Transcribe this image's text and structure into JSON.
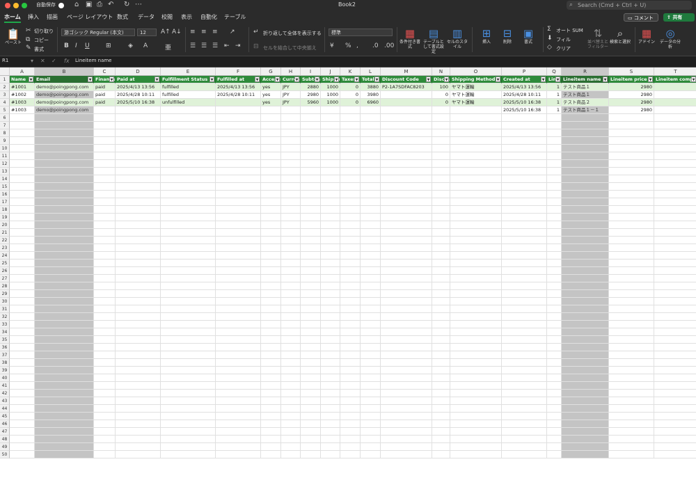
{
  "titlebar": {
    "autosave_label": "自動保存",
    "title": "Book2",
    "search_placeholder": "Search (Cmd + Ctrl + U)"
  },
  "menu": {
    "items": [
      "ホーム",
      "挿入",
      "描画",
      "ページ レイアウト",
      "数式",
      "データ",
      "校閲",
      "表示",
      "自動化",
      "テーブル"
    ],
    "comment_label": "コメント",
    "share_label": "共有"
  },
  "ribbon": {
    "paste": "ペースト",
    "cut": "切り取り",
    "copy": "コピー",
    "format": "書式",
    "font_name": "游ゴシック Regular (本文)",
    "font_size": "12",
    "wrap_text": "折り返して全体を表示する",
    "merge_center": "セルを結合して中央揃え",
    "number_format": "標準",
    "conditional_format": "条件付き書式",
    "format_as_table": "テーブルとして書式設定",
    "cell_styles": "セルのスタイル",
    "insert": "挿入",
    "delete": "削除",
    "format_cells": "書式",
    "autosum": "オート SUM",
    "fill": "フィル",
    "clear": "クリア",
    "sort_filter": "並べ替えとフィルター",
    "find_select": "検索と選択",
    "addins": "アドイン",
    "analyze_data": "データの分析"
  },
  "formula_bar": {
    "name_box": "R1",
    "content": "Lineitem name"
  },
  "grid": {
    "columns": [
      {
        "letter": "A",
        "header": "Name"
      },
      {
        "letter": "B",
        "header": "Email"
      },
      {
        "letter": "C",
        "header": "Financial Status"
      },
      {
        "letter": "D",
        "header": "Paid at"
      },
      {
        "letter": "E",
        "header": "Fulfillment Status"
      },
      {
        "letter": "F",
        "header": "Fulfilled at"
      },
      {
        "letter": "G",
        "header": "Accepts Marketing"
      },
      {
        "letter": "H",
        "header": "Currency"
      },
      {
        "letter": "I",
        "header": "Subtotal"
      },
      {
        "letter": "J",
        "header": "Shipping"
      },
      {
        "letter": "K",
        "header": "Taxes"
      },
      {
        "letter": "L",
        "header": "Total"
      },
      {
        "letter": "M",
        "header": "Discount Code"
      },
      {
        "letter": "N",
        "header": "Discount Amount"
      },
      {
        "letter": "O",
        "header": "Shipping Method"
      },
      {
        "letter": "P",
        "header": "Created at"
      },
      {
        "letter": "Q",
        "header": "Lineitem quantity"
      },
      {
        "letter": "R",
        "header": "Lineitem name"
      },
      {
        "letter": "S",
        "header": "Lineitem price"
      },
      {
        "letter": "T",
        "header": "Lineitem compare"
      }
    ],
    "rows": [
      [
        "#1001",
        "demo@poingpong.com",
        "paid",
        "2025/4/13 13:56",
        "fulfilled",
        "2025/4/13 13:56",
        "yes",
        "JPY",
        "2880",
        "1000",
        "0",
        "3880",
        "P2-1A7SDFAC8203",
        "100",
        "ヤマト運輸",
        "2025/4/13 13:56",
        "1",
        "テスト商品１",
        "2980",
        ""
      ],
      [
        "#1002",
        "demo@poingpong.com",
        "paid",
        "2025/4/28 10:11",
        "fulfilled",
        "2025/4/28 10:11",
        "yes",
        "JPY",
        "2980",
        "1000",
        "0",
        "3980",
        "",
        "0",
        "ヤマト運輸",
        "2025/4/28 10:11",
        "1",
        "テスト商品１",
        "2980",
        ""
      ],
      [
        "#1003",
        "demo@poingpong.com",
        "paid",
        "2025/5/10 16:38",
        "unfulfilled",
        "",
        "yes",
        "JPY",
        "5960",
        "1000",
        "0",
        "6960",
        "",
        "0",
        "ヤマト運輸",
        "2025/5/10 16:38",
        "1",
        "テスト商品２",
        "2980",
        ""
      ],
      [
        "#1003",
        "demo@poingpong.com",
        "",
        "",
        "",
        "",
        "",
        "",
        "",
        "",
        "",
        "",
        "",
        "",
        "",
        "2025/5/10 16:38",
        "1",
        "テスト商品１－１",
        "2980",
        ""
      ]
    ],
    "row_count": 50
  }
}
